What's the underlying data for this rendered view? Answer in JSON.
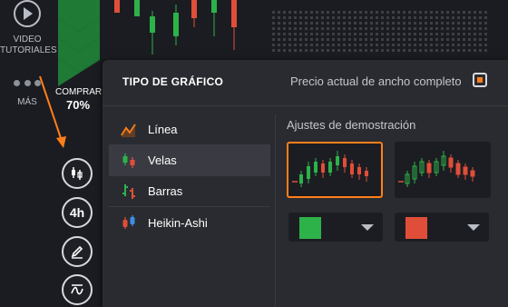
{
  "left_rail": {
    "video_line1": "VIDEO",
    "video_line2": "TUTORIALES",
    "more_label": "MÁS",
    "buy_label": "COMPRAR",
    "buy_percent": "70%",
    "timeframe": "4h"
  },
  "panel": {
    "title": "TIPO DE GRÁFICO",
    "full_price_label": "Precio actual de ancho completo",
    "full_price_checked": true,
    "demo_label": "Ajustes de demostración",
    "types": [
      {
        "label": "Línea",
        "icon": "line-chart-icon",
        "active": false
      },
      {
        "label": "Velas",
        "icon": "candles-icon",
        "active": true
      },
      {
        "label": "Barras",
        "icon": "bars-icon",
        "active": false
      },
      {
        "label": "Heikin-Ashi",
        "icon": "heikin-ashi-icon",
        "active": false
      }
    ],
    "colors": {
      "up": "#2db24a",
      "down": "#e04e39",
      "accent": "#ff7f1a"
    }
  }
}
